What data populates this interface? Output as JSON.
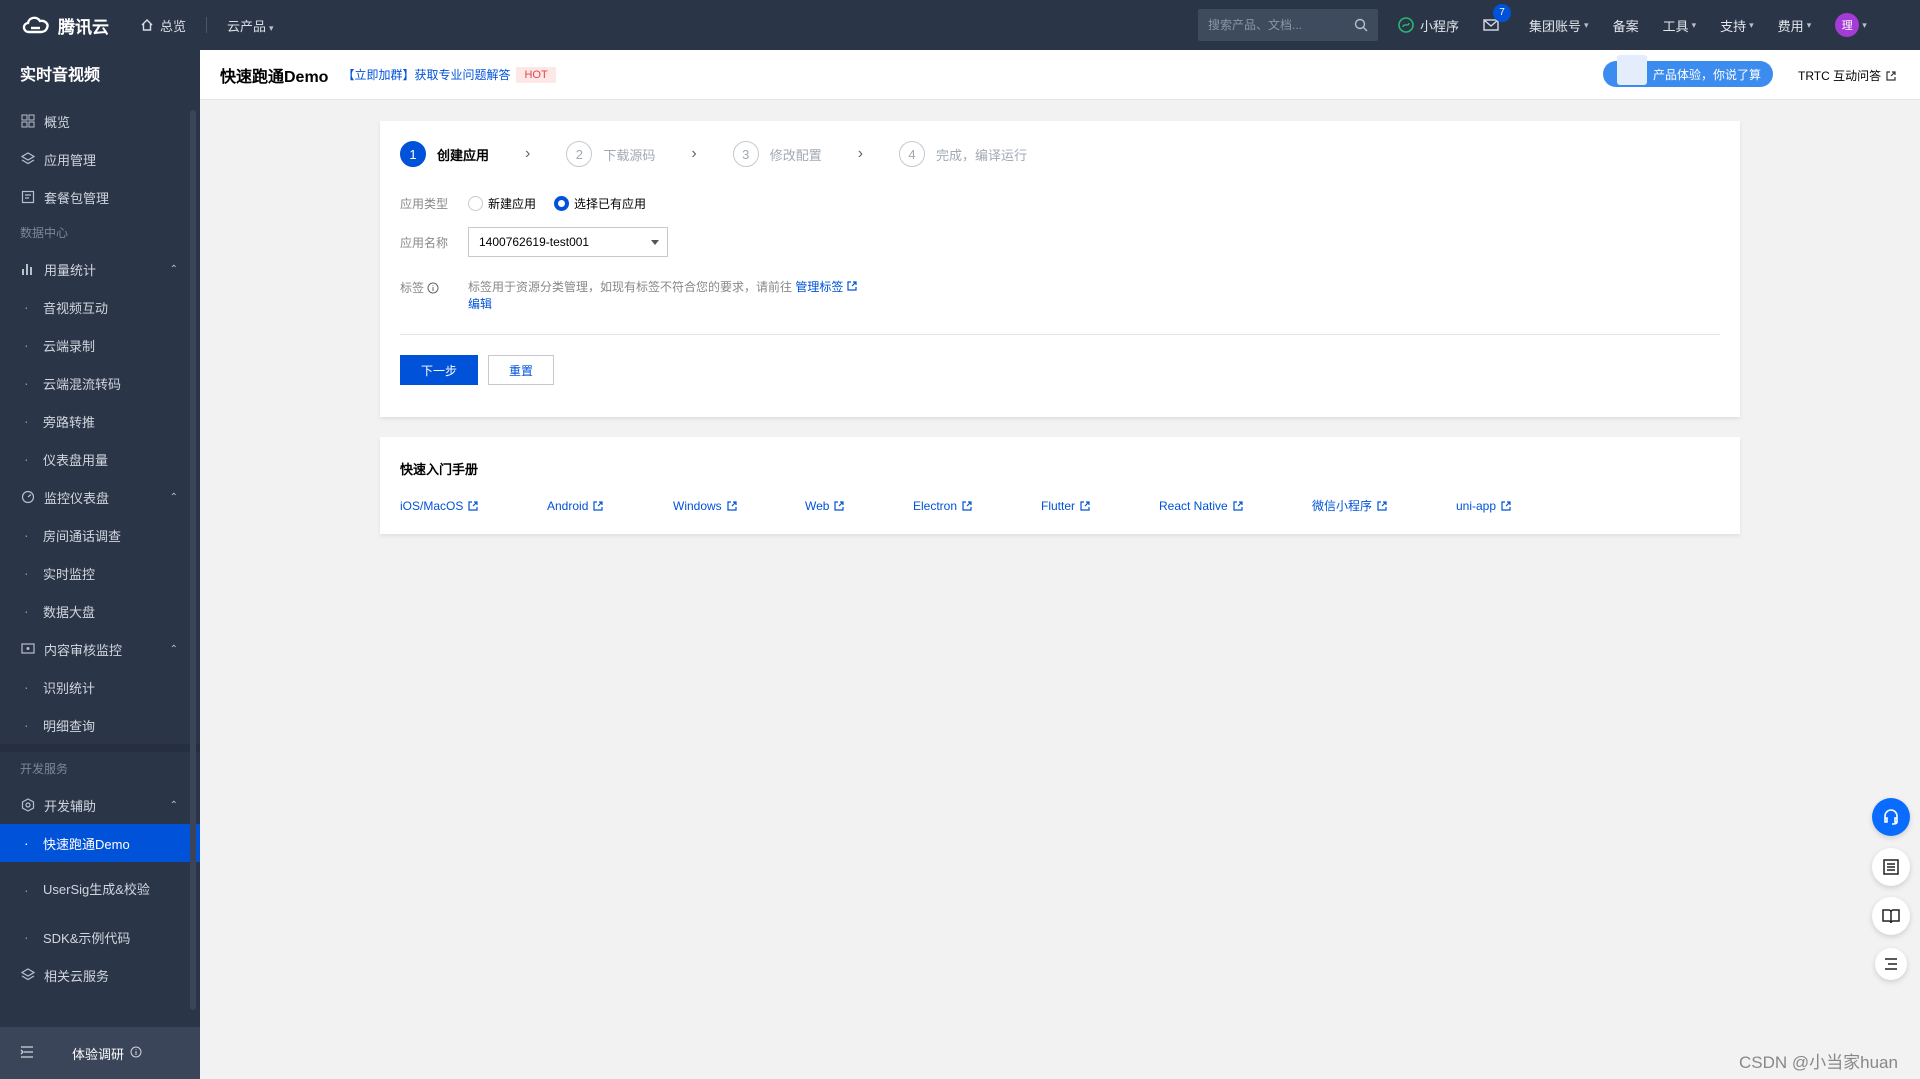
{
  "topbar": {
    "logo_text": "腾讯云",
    "home_label": "总览",
    "products_label": "云产品",
    "search_placeholder": "搜索产品、文档...",
    "mini_program": "小程序",
    "mail_count": "7",
    "group_account": "集团账号",
    "filing": "备案",
    "tools": "工具",
    "support": "支持",
    "billing": "费用",
    "avatar_text": "理"
  },
  "sidebar": {
    "title": "实时音视频",
    "items": [
      {
        "label": "概览"
      },
      {
        "label": "应用管理"
      },
      {
        "label": "套餐包管理"
      }
    ],
    "data_center_label": "数据中心",
    "usage_stats": {
      "label": "用量统计",
      "subs": [
        "音视频互动",
        "云端录制",
        "云端混流转码",
        "旁路转推",
        "仪表盘用量"
      ]
    },
    "monitor": {
      "label": "监控仪表盘",
      "subs": [
        "房间通话调查",
        "实时监控",
        "数据大盘"
      ]
    },
    "moderation": {
      "label": "内容审核监控",
      "subs": [
        "识别统计",
        "明细查询"
      ]
    },
    "dev_service_label": "开发服务",
    "dev_assist": {
      "label": "开发辅助",
      "subs": [
        "快速跑通Demo",
        "UserSig生成&校验",
        "SDK&示例代码"
      ]
    },
    "related_label": "相关云服务",
    "footer_label": "体验调研"
  },
  "header": {
    "title": "快速跑通Demo",
    "join_link": "【立即加群】获取专业问题解答",
    "hot": "HOT",
    "promo": "产品体验，你说了算",
    "trtc_link": "TRTC 互动问答"
  },
  "steps": [
    {
      "num": "1",
      "label": "创建应用"
    },
    {
      "num": "2",
      "label": "下载源码"
    },
    {
      "num": "3",
      "label": "修改配置"
    },
    {
      "num": "4",
      "label": "完成，编译运行"
    }
  ],
  "form": {
    "app_type_label": "应用类型",
    "radio_new": "新建应用",
    "radio_existing": "选择已有应用",
    "app_name_label": "应用名称",
    "app_name_value": "1400762619-test001",
    "tag_label": "标签",
    "tag_desc": "标签用于资源分类管理，如现有标签不符合您的要求，请前往",
    "tag_manage": "管理标签",
    "tag_edit": "编辑",
    "next_btn": "下一步",
    "reset_btn": "重置"
  },
  "quickstart": {
    "title": "快速入门手册",
    "links": [
      "iOS/MacOS",
      "Android",
      "Windows",
      "Web",
      "Electron",
      "Flutter",
      "React Native",
      "微信小程序",
      "uni-app"
    ]
  },
  "watermark": "CSDN @小当家huan",
  "colors": {
    "accent": "#0052d9",
    "topbar": "#2b3548"
  }
}
